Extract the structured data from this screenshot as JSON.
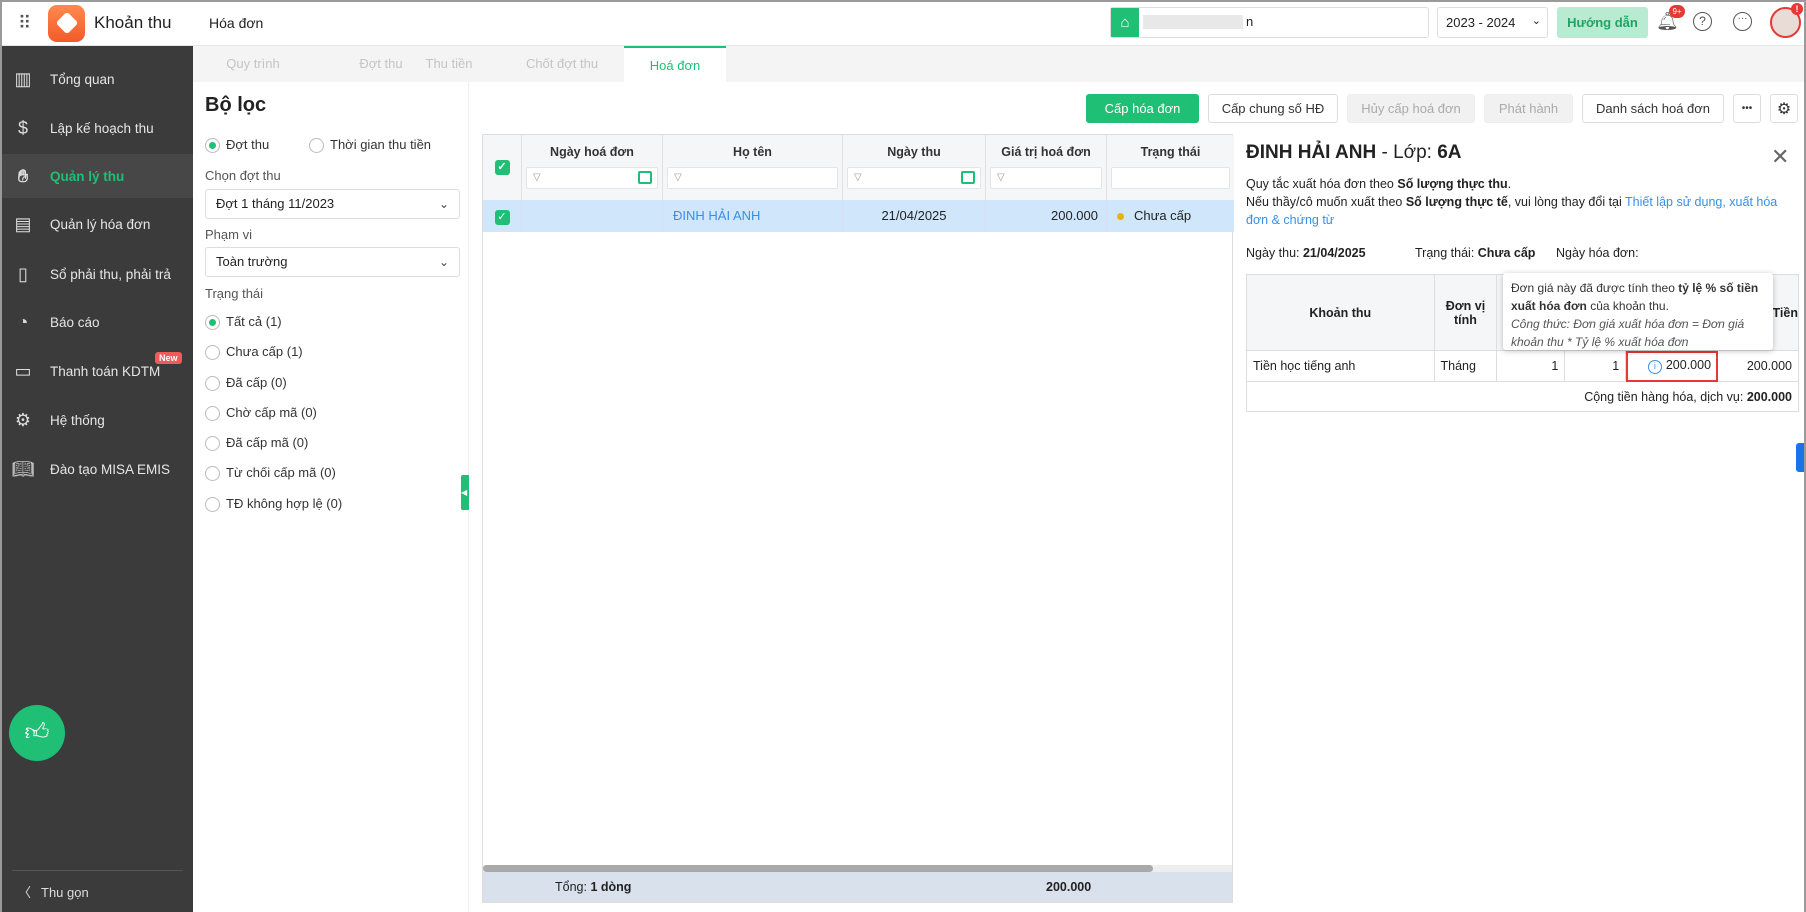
{
  "header": {
    "app_name": "Khoản thu",
    "page_title": "Hóa đơn",
    "search_value": "n",
    "year": "2023 - 2024",
    "guide_button": "Hướng dẫn",
    "notification_badge": "9+",
    "avatar_badge": "!"
  },
  "sidebar": {
    "items": [
      {
        "label": "Tổng quan",
        "icon": "bar-chart-icon"
      },
      {
        "label": "Lập kế hoạch thu",
        "icon": "calendar-dollar-icon"
      },
      {
        "label": "Quản lý thu",
        "icon": "hand-coin-icon",
        "active": true
      },
      {
        "label": "Quản lý hóa đơn",
        "icon": "document-icon"
      },
      {
        "label": "Sổ phải thu, phải trả",
        "icon": "ledger-icon"
      },
      {
        "label": "Báo cáo",
        "icon": "pie-chart-icon"
      },
      {
        "label": "Thanh toán KDTM",
        "icon": "card-icon",
        "badge": "New"
      },
      {
        "label": "Hệ thống",
        "icon": "gear-icon"
      },
      {
        "label": "Đào tạo MISA EMIS",
        "icon": "book-icon"
      }
    ],
    "collapse_label": "Thu gọn"
  },
  "tabs": [
    "Quy trình",
    "Đợt thu",
    "Thu tiền",
    "Chốt đợt thu",
    "Hoá đơn"
  ],
  "filter": {
    "title": "Bộ lọc",
    "mode_options": [
      "Đợt thu",
      "Thời gian thu tiền"
    ],
    "batch_label": "Chọn đợt thu",
    "batch_value": "Đợt 1 tháng 11/2023",
    "scope_label": "Phạm vi",
    "scope_value": "Toàn trường",
    "status_label": "Trạng thái",
    "status_options": [
      "Tất cả (1)",
      "Chưa cấp (1)",
      "Đã cấp (0)",
      "Chờ cấp mã (0)",
      "Đã cấp mã (0)",
      "Từ chối cấp mã (0)",
      "TĐ không hợp lệ (0)"
    ]
  },
  "toolbar": {
    "issue": "Cấp hóa đơn",
    "issue_common": "Cấp chung số HĐ",
    "cancel_issue": "Hủy cấp hoá đơn",
    "publish": "Phát hành",
    "list": "Danh sách hoá đơn",
    "more": "•••"
  },
  "grid": {
    "columns": [
      "Ngày hoá đơn",
      "Họ tên",
      "Ngày thu",
      "Giá trị hoá đơn",
      "Trạng thái"
    ],
    "rows": [
      {
        "invoice_date": "",
        "name": "ĐINH HẢI ANH",
        "date": "21/04/2025",
        "value": "200.000",
        "status": "Chưa cấp"
      }
    ],
    "footer_label": "Tổng:",
    "footer_count": "1 dòng",
    "footer_total": "200.000"
  },
  "detail": {
    "name": "ĐINH HẢI ANH",
    "class_label": " - Lớp: ",
    "class": "6A",
    "rule_prefix": "Quy tắc xuất hóa đơn theo ",
    "rule_bold": "Số lượng thực thu",
    "rule_suffix": ".",
    "change_prefix": "Nếu thầy/cô muốn xuất theo ",
    "change_bold": "Số lượng thực tế",
    "change_mid": ", vui lòng thay đổi tại ",
    "change_link": "Thiết lập sử dụng, xuất hóa đơn & chứng từ",
    "date_label": "Ngày thu: ",
    "date": "21/04/2025",
    "status_label": "Trạng thái: ",
    "status": "Chưa cấp",
    "invoice_date_label": "Ngày hóa đơn:",
    "columns": [
      "Khoản thu",
      "Đơn vị tính",
      "Tiền"
    ],
    "row": {
      "item": "Tiền học tiếng anh",
      "unit": "Tháng",
      "qty1": "1",
      "qty2": "1",
      "price": "200.000",
      "amount": "200.000"
    },
    "total_label": "Cộng tiền hàng hóa, dịch vụ: ",
    "total": "200.000",
    "tooltip": {
      "t1": "Đơn giá này đã được tính theo ",
      "b1": "tỷ lệ % số tiền xuất hóa đơn",
      "t2": " của khoản thu.",
      "formula": "Công thức: Đơn giá xuất hóa đơn = Đơn giá khoản thu * Tỷ lệ % xuất hóa đơn"
    }
  },
  "colors": {
    "accent": "#1fbf75",
    "sidebar": "#3b3b3b",
    "selected_row": "#cfe6fb",
    "link": "#3a8ee6",
    "highlight": "#e53935"
  }
}
